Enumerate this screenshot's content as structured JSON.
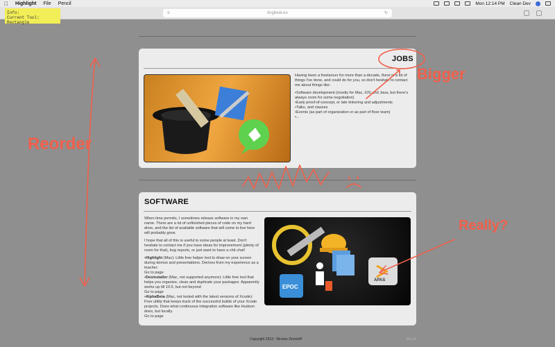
{
  "menubar": {
    "app_name": "Highlight",
    "menus": [
      "File",
      "Pencil"
    ],
    "clock": "Mon 12:14 PM",
    "user": "Clean Dev"
  },
  "browser": {
    "url": "tingbeat.eu"
  },
  "info_box": {
    "line1": "Info:",
    "line2": "Current Tool: Rectangle"
  },
  "jobs": {
    "title": "JOBS",
    "intro": "Having been a freelancer for more than a decade, there is a lot of things I've done, and could do for you, so don't hesitate to contact me about things like:",
    "items": [
      "Software development (mostly for Mac, iOS and Java, but there's always room for some negotiation)",
      "Early proof-of-concept, or late tinkering and adjustments",
      "Talks, and classes",
      "Events (as part of organization or as part of floor team)",
      "..."
    ]
  },
  "software": {
    "title": "SOFTWARE",
    "para1": "When time permits, I sometimes release software in my own name. There are a lot of unfinished pieces of code on my hard drive, and the list of available software that will come to live here will probably grow.",
    "para2": "I hope that all of this is useful to some people at least. Don't hesitate to contact me if you have ideas for improvement (plenty of room for that), bug reports, or just want to have a chit chat!",
    "items": [
      {
        "name": "Highlight",
        "desc": "(Mac): Little free helper tool to draw on your screen during demos and presentations. Derives from my experience as a teacher.",
        "link": "Go to page"
      },
      {
        "name": "Desinstaller",
        "desc": "(Mac, not supported anymore): Little free tool that helps you organize, clean and duplicate your packages. Apparently works up till 10.5, but not beyond",
        "link": "Go to page"
      },
      {
        "name": "AlphaBeta",
        "desc": "(Mac, not tested with the latest versions of Xcode): Free utility that keeps track of the successful builds of your Xcode projects. Does what continuous integration software like Hudson does, but locally.",
        "link": "Go to page"
      }
    ],
    "icon_labels": [
      "EPOC",
      "APAS"
    ]
  },
  "footer": {
    "copyright": "Copyright 2013 - Nicolas Zinovieff",
    "version": "Fix 12"
  },
  "annotations": {
    "bigger": "Bigger",
    "reorder": "Reorder",
    "really": "Really?",
    "color": "#f0604b"
  }
}
